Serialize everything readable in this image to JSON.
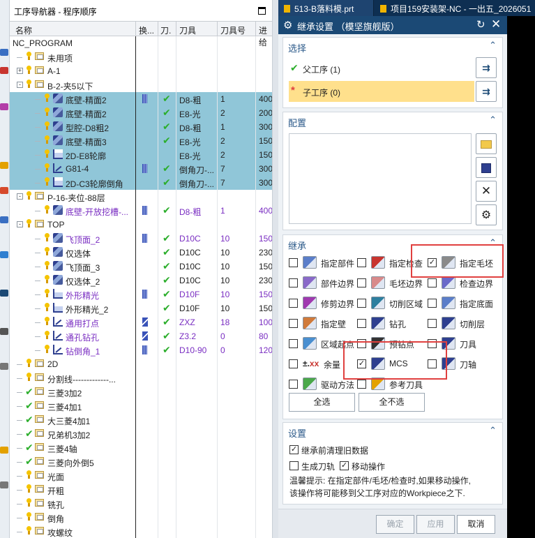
{
  "navigator": {
    "title": "工序导航器 - 程序顺序",
    "columns": [
      "名称",
      "换...",
      "刀.",
      "刀具",
      "刀具号",
      "进给"
    ],
    "rows": [
      {
        "level": 0,
        "name": "NC_PROGRAM",
        "type": "root"
      },
      {
        "level": 1,
        "name": "未用项",
        "type": "folder"
      },
      {
        "level": 1,
        "name": "A-1",
        "type": "group",
        "expand": "+"
      },
      {
        "level": 1,
        "name": "B-2-夹5以下",
        "type": "group",
        "expand": "-"
      },
      {
        "level": 2,
        "name": "底壁-精面2",
        "type": "op",
        "icon": "mill",
        "selected": true,
        "change": "stripe",
        "check": "✔",
        "tool": "D8-粗",
        "toolno": "1",
        "feed": "400"
      },
      {
        "level": 2,
        "name": "底壁-精面2",
        "type": "op",
        "icon": "mill",
        "selected": true,
        "change": "",
        "check": "✔",
        "tool": "E8-光",
        "toolno": "2",
        "feed": "200"
      },
      {
        "level": 2,
        "name": "型腔-D8粗2",
        "type": "op",
        "icon": "mill",
        "selected": true,
        "change": "",
        "check": "✔",
        "tool": "D8-粗",
        "toolno": "1",
        "feed": "300"
      },
      {
        "level": 2,
        "name": "底壁-精面3",
        "type": "op",
        "icon": "mill",
        "selected": true,
        "change": "",
        "check": "✔",
        "tool": "E8-光",
        "toolno": "2",
        "feed": "150"
      },
      {
        "level": 2,
        "name": "2D-E8轮廓",
        "type": "op",
        "icon": "prof",
        "selected": true,
        "change": "",
        "check": "",
        "tool": "E8-光",
        "toolno": "2",
        "feed": "150"
      },
      {
        "level": 2,
        "name": "G81-4",
        "type": "op",
        "icon": "g81",
        "selected": true,
        "change": "stripe",
        "check": "✔",
        "tool": "倒角刀-...",
        "toolno": "7",
        "feed": "300"
      },
      {
        "level": 2,
        "name": "2D-C3轮廓倒角",
        "type": "op",
        "icon": "prof",
        "selected": true,
        "change": "",
        "check": "✔",
        "tool": "倒角刀-...",
        "toolno": "7",
        "feed": "300"
      },
      {
        "level": 1,
        "name": "P-16-夹位-88层",
        "type": "group",
        "expand": "-"
      },
      {
        "level": 2,
        "name": "底壁-开放挖槽-...",
        "type": "op",
        "icon": "mill",
        "purple": true,
        "change": "stripe",
        "check": "✔",
        "tool": "D8-粗",
        "toolno": "1",
        "feed": "400"
      },
      {
        "level": 1,
        "name": "TOP",
        "type": "group",
        "expand": "-"
      },
      {
        "level": 2,
        "name": "飞顶面_2",
        "type": "op",
        "icon": "mill",
        "purple": true,
        "change": "stripe",
        "check": "✔",
        "tool": "D10C",
        "toolno": "10",
        "feed": "150"
      },
      {
        "level": 2,
        "name": "仅选体",
        "type": "op",
        "icon": "mill",
        "change": "",
        "check": "✔",
        "tool": "D10C",
        "toolno": "10",
        "feed": "230"
      },
      {
        "level": 2,
        "name": "飞顶面_3",
        "type": "op",
        "icon": "mill",
        "change": "",
        "check": "✔",
        "tool": "D10C",
        "toolno": "10",
        "feed": "150"
      },
      {
        "level": 2,
        "name": "仅选体_2",
        "type": "op",
        "icon": "mill",
        "change": "",
        "check": "✔",
        "tool": "D10C",
        "toolno": "10",
        "feed": "230"
      },
      {
        "level": 2,
        "name": "外形精光",
        "type": "op",
        "icon": "prof",
        "purple": true,
        "change": "stripe",
        "check": "✔",
        "tool": "D10F",
        "toolno": "10",
        "feed": "150"
      },
      {
        "level": 2,
        "name": "外形精光_2",
        "type": "op",
        "icon": "prof",
        "change": "",
        "check": "✔",
        "tool": "D10F",
        "toolno": "10",
        "feed": "150"
      },
      {
        "level": 2,
        "name": "通用打点",
        "type": "op",
        "icon": "g81",
        "purple": true,
        "change": "drill",
        "check": "✔",
        "tool": "ZXZ",
        "toolno": "18",
        "feed": "100"
      },
      {
        "level": 2,
        "name": "通孔钻孔",
        "type": "op",
        "icon": "g81",
        "purple": true,
        "change": "drill",
        "check": "✔",
        "tool": "Z3.2",
        "toolno": "0",
        "feed": "80"
      },
      {
        "level": 2,
        "name": "钻倒角_1",
        "type": "op",
        "icon": "g81",
        "purple": true,
        "change": "stripe",
        "check": "✔",
        "tool": "D10-90",
        "toolno": "0",
        "feed": "120"
      },
      {
        "level": 1,
        "name": "2D",
        "type": "folder"
      },
      {
        "level": 1,
        "name": "分割线-------------...",
        "type": "folder"
      },
      {
        "level": 1,
        "name": "三菱3加2",
        "type": "folder",
        "green": true
      },
      {
        "level": 1,
        "name": "三菱4加1",
        "type": "folder",
        "green": true
      },
      {
        "level": 1,
        "name": "大三菱4加1",
        "type": "folder",
        "green": true
      },
      {
        "level": 1,
        "name": "兄弟机3加2",
        "type": "folder",
        "green": true
      },
      {
        "level": 1,
        "name": "三菱4轴",
        "type": "folder",
        "green": true
      },
      {
        "level": 1,
        "name": "三菱向外倒5",
        "type": "folder",
        "green": true
      },
      {
        "level": 1,
        "name": "光面",
        "type": "folder"
      },
      {
        "level": 1,
        "name": "开粗",
        "type": "folder"
      },
      {
        "level": 1,
        "name": "铣孔",
        "type": "folder"
      },
      {
        "level": 1,
        "name": "倒角",
        "type": "folder"
      },
      {
        "level": 1,
        "name": "攻螺纹",
        "type": "folder"
      }
    ]
  },
  "tabs": {
    "tab1": "513-B落料模.prt",
    "tab2": "项目159安装架-NC - 一出五_2026051"
  },
  "dialog": {
    "title": "继承设置 （模坚旗舰版）",
    "select_section": {
      "title": "选择",
      "parent_label": "父工序 (1)",
      "child_label": "子工序 (0)"
    },
    "config_section": {
      "title": "配置"
    },
    "inherit_section": {
      "title": "继承",
      "items": [
        {
          "label": "指定部件",
          "checked": false
        },
        {
          "label": "指定检查",
          "checked": false
        },
        {
          "label": "指定毛坯",
          "checked": true
        },
        {
          "label": "部件边界",
          "checked": false
        },
        {
          "label": "毛坯边界",
          "checked": false
        },
        {
          "label": "检查边界",
          "checked": false
        },
        {
          "label": "修剪边界",
          "checked": false
        },
        {
          "label": "切削区域",
          "checked": false
        },
        {
          "label": "指定底面",
          "checked": false
        },
        {
          "label": "指定壁",
          "checked": false
        },
        {
          "label": "钻孔",
          "checked": false
        },
        {
          "label": "切削层",
          "checked": false
        },
        {
          "label": "区域起点",
          "checked": false
        },
        {
          "label": "预钻点",
          "checked": false
        },
        {
          "label": "刀具",
          "checked": false
        },
        {
          "label": "余量",
          "prefix": "±.xx",
          "checked": false
        },
        {
          "label": "MCS",
          "checked": true
        },
        {
          "label": "刀轴",
          "checked": false
        },
        {
          "label": "驱动方法",
          "checked": false
        },
        {
          "label": "参考刀具",
          "checked": false
        }
      ],
      "select_all": "全选",
      "deselect_all": "全不选"
    },
    "settings_section": {
      "title": "设置",
      "clear_old": "继承前清理旧数据",
      "clear_old_checked": true,
      "gen_path": "生成刀轨",
      "gen_path_checked": false,
      "move_op": "移动操作",
      "move_op_checked": true,
      "hint_line1": "温馨提示: 在指定部件/毛坯/检查时,如果移动操作,",
      "hint_line2": "该操作将可能移到父工序对应的Workpiece之下."
    },
    "footer": {
      "ok": "确定",
      "apply": "应用",
      "cancel": "取消"
    }
  },
  "colors": {
    "selected_row": "#90c6d8",
    "purple_text": "#7a2ec2",
    "dialog_title_bg": "#1b4975",
    "child_op_highlight": "#ffe08c",
    "annotation_red": "#e0403f"
  }
}
